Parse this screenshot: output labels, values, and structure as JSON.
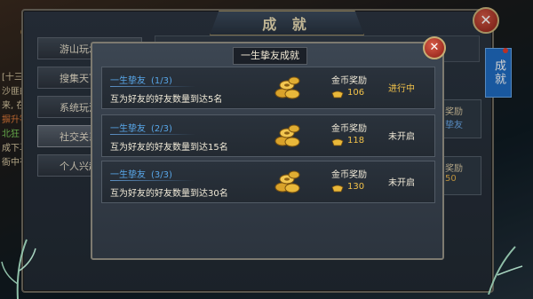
{
  "main_window": {
    "title": "成 就",
    "close_glyph": "✕",
    "side_items": [
      {
        "label": "游山玩水"
      },
      {
        "label": "搜集天下"
      },
      {
        "label": "系统玩法"
      },
      {
        "label": "社交关系",
        "active": true
      },
      {
        "label": "个人兴趣"
      }
    ],
    "right_tab_label": "成就",
    "behind_peek": [
      {
        "line1": "奖励",
        "line2": "挚友",
        "line2_color": "blue"
      },
      {
        "line1": "奖励",
        "line2": "50",
        "line2_color": "gold"
      }
    ]
  },
  "background_text": [
    {
      "text": "[十三",
      "color": "normal"
    },
    {
      "text": "沙匪的",
      "color": "normal"
    },
    {
      "text": "来, 在",
      "color": "normal"
    },
    {
      "text": "摒升等",
      "color": "red"
    },
    {
      "text": "北狂",
      "color": "green"
    },
    {
      "text": "成下马",
      "color": "normal"
    },
    {
      "text": "衙中有",
      "color": "normal"
    }
  ],
  "popup": {
    "title": "一生挚友成就",
    "close_glyph": "✕",
    "rows": [
      {
        "name": "一生挚友",
        "progress": "(1/3)",
        "desc": "互为好友的好友数量到达5名",
        "reward_label": "金币奖励",
        "reward_amount": "106",
        "status": "进行中",
        "status_type": "active"
      },
      {
        "name": "一生挚友",
        "progress": "(2/3)",
        "desc": "互为好友的好友数量到达15名",
        "reward_label": "金币奖励",
        "reward_amount": "118",
        "status": "未开启",
        "status_type": "locked"
      },
      {
        "name": "一生挚友",
        "progress": "(3/3)",
        "desc": "互为好友的好友数量到达30名",
        "reward_label": "金币奖励",
        "reward_amount": "130",
        "status": "未开启",
        "status_type": "locked"
      }
    ]
  },
  "colors": {
    "accent_blue": "#58a6e8",
    "gold": "#f2c24a",
    "close_red": "#b8352a"
  }
}
